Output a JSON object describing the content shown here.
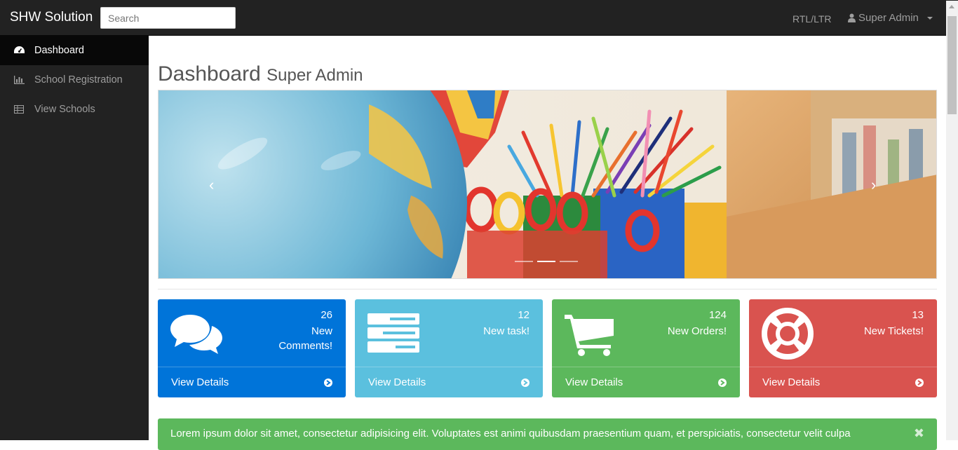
{
  "navbar": {
    "brand": "SHW Solution",
    "search_placeholder": "Search",
    "rtl_label": "RTL/LTR",
    "user_label": "Super Admin"
  },
  "sidebar": {
    "items": [
      {
        "label": "Dashboard",
        "icon": "dashboard-icon",
        "active": true
      },
      {
        "label": "School Registration",
        "icon": "bar-chart-icon",
        "active": false
      },
      {
        "label": "View Schools",
        "icon": "table-icon",
        "active": false
      }
    ]
  },
  "page": {
    "title": "Dashboard",
    "subtitle": "Super Admin"
  },
  "carousel": {
    "prev": "‹",
    "next": "›",
    "slides": 3,
    "active_slide": 1
  },
  "panels": [
    {
      "count": "26",
      "label": "New Comments!",
      "footer": "View Details",
      "color": "#0074d9",
      "icon": "comments-icon"
    },
    {
      "count": "12",
      "label": "New task!",
      "footer": "View Details",
      "color": "#5bc0de",
      "icon": "tasks-icon"
    },
    {
      "count": "124",
      "label": "New Orders!",
      "footer": "View Details",
      "color": "#5cb85c",
      "icon": "shopping-cart-icon"
    },
    {
      "count": "13",
      "label": "New Tickets!",
      "footer": "View Details",
      "color": "#d9534f",
      "icon": "support-icon"
    }
  ],
  "alert": {
    "text": "Lorem ipsum dolor sit amet, consectetur adipisicing elit. Voluptates est animi quibusdam praesentium quam, et perspiciatis, consectetur velit culpa",
    "close": "✖",
    "color": "#5cb85c"
  }
}
